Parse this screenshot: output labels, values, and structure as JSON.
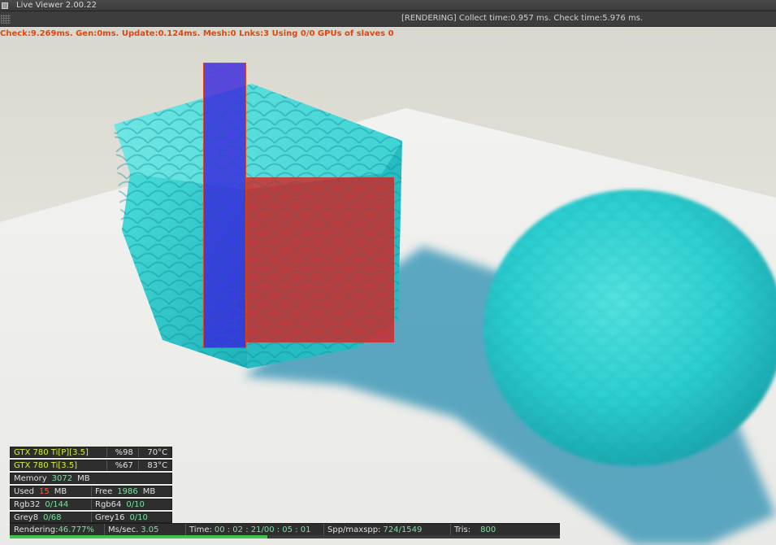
{
  "window": {
    "title": "Live Viewer 2.00.22"
  },
  "status": {
    "text": "[RENDERING] Collect time:0.957 ms.  Check time:5.976 ms."
  },
  "overlay": {
    "stats": "Check:9.269ms. Gen:0ms. Update:0.124ms. Mesh:0 Lnks:3   Using 0/0 GPUs of slaves 0"
  },
  "gpus": [
    {
      "name": "GTX 780 Ti[P][3.5]",
      "load": "%98",
      "temp": "70°C"
    },
    {
      "name": "GTX 780 Ti[3.5]",
      "load": "%67",
      "temp": "83°C"
    }
  ],
  "memory": {
    "label": "Memory",
    "total": "3072",
    "unit": "MB",
    "used_label": "Used",
    "used": "15",
    "free_label": "Free",
    "free": "1986"
  },
  "textures": {
    "rgb32_label": "Rgb32",
    "rgb32": "0/144",
    "rgb64_label": "Rgb64",
    "rgb64": "0/10",
    "grey8_label": "Grey8",
    "grey8": "0/68",
    "grey16_label": "Grey16",
    "grey16": "0/10"
  },
  "render": {
    "rendering_label": "Rendering:",
    "rendering": "46.777%",
    "rendering_fraction": 0.46777,
    "mssec_label": "Ms/sec.",
    "mssec": "3.05",
    "time_label": "Time:",
    "time": "00 : 02 : 21/00 : 05 : 01",
    "spp_label": "Spp/maxspp:",
    "spp": "724/1549",
    "tris_label": "Tris:",
    "tris": "800"
  },
  "colors": {
    "accent_orange": "#e2460c",
    "gpu_name": "#d7ef2c",
    "value_green": "#7ee0a0",
    "value_red": "#ff5a3c",
    "progress": "#3ec24a",
    "cyan_object": "#2fcfd2",
    "region_blue": "#3a1fe0",
    "region_red": "#e01b1b"
  }
}
